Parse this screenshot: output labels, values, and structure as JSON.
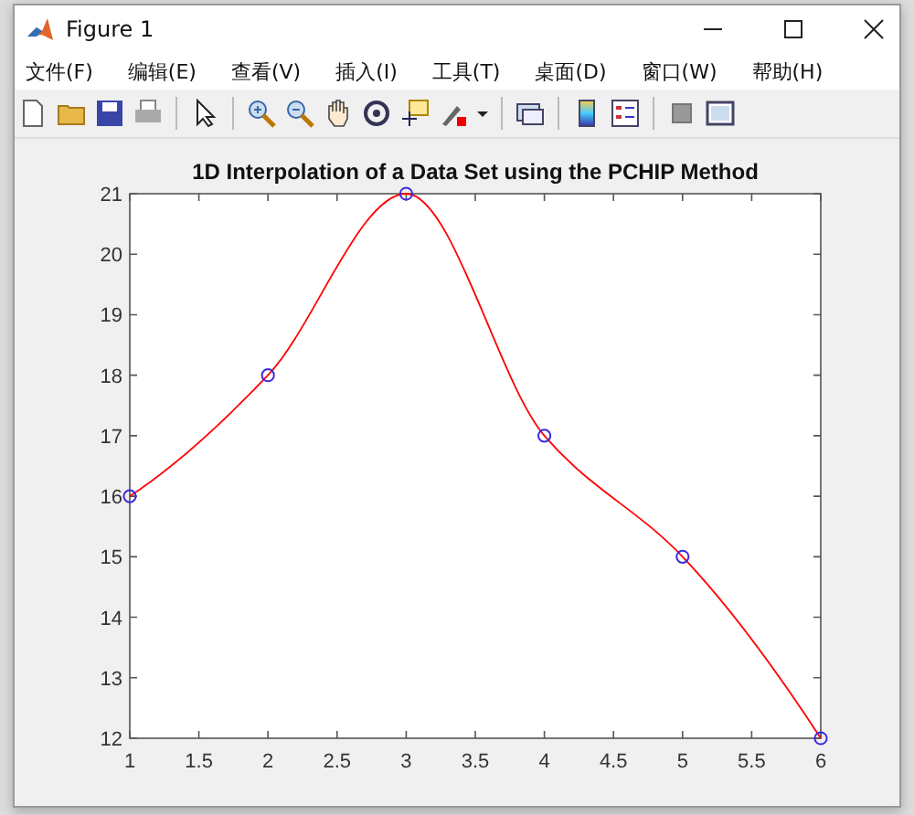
{
  "window": {
    "title": "Figure 1"
  },
  "menu": [
    "文件(F)",
    "编辑(E)",
    "查看(V)",
    "插入(I)",
    "工具(T)",
    "桌面(D)",
    "窗口(W)",
    "帮助(H)"
  ],
  "plot": {
    "chart_data": {
      "type": "line",
      "title": "1D Interpolation of a Data Set using the PCHIP Method",
      "x": [
        1,
        2,
        3,
        4,
        5,
        6
      ],
      "series": [
        {
          "color": "#ff0000",
          "marker": "o",
          "values": [
            16,
            18,
            21,
            17,
            15,
            12
          ]
        }
      ],
      "xlim": [
        1,
        6
      ],
      "ylim": [
        12,
        21
      ],
      "xticks": [
        1,
        1.5,
        2,
        2.5,
        3,
        3.5,
        4,
        4.5,
        5,
        5.5,
        6
      ],
      "yticks": [
        12,
        13,
        14,
        15,
        16,
        17,
        18,
        19,
        20,
        21
      ]
    }
  }
}
